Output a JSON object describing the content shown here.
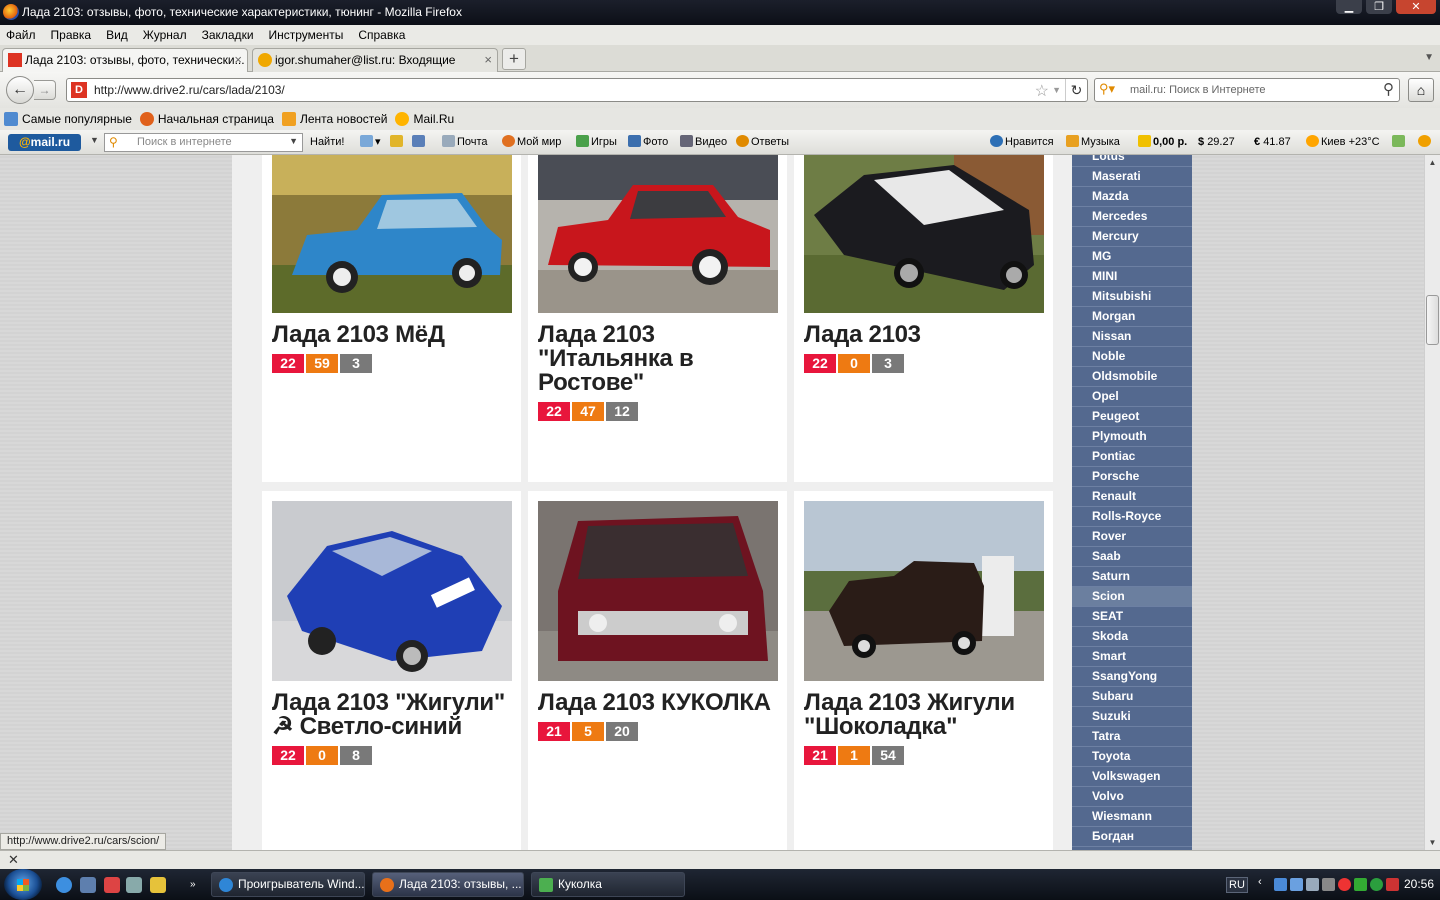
{
  "window": {
    "title": "Лада 2103: отзывы, фото, технические характеристики, тюнинг - Mozilla Firefox"
  },
  "menu": [
    "Файл",
    "Правка",
    "Вид",
    "Журнал",
    "Закладки",
    "Инструменты",
    "Справка"
  ],
  "tabs": [
    {
      "label": "Лада 2103: отзывы, фото, технически..."
    },
    {
      "label": "igor.shumaher@list.ru: Входящие"
    }
  ],
  "nav": {
    "url": "http://www.drive2.ru/cars/lada/2103/",
    "site_icon": "D",
    "search_placeholder": "mail.ru: Поиск в Интернете"
  },
  "bookmarks": [
    "Самые популярные",
    "Начальная страница",
    "Лента новостей",
    "Mail.Ru"
  ],
  "mailbar": {
    "logo": "mail.ru",
    "search_placeholder": "Поиск в интернете",
    "find": "Найти!",
    "items": [
      "Почта",
      "Мой мир",
      "Игры",
      "Фото",
      "Видео",
      "Ответы"
    ],
    "like": "Нравится",
    "music": "Музыка",
    "balance": "0,00 р.",
    "usd": "29.27",
    "eur": "41.87",
    "weather": "Киев +23°C"
  },
  "cars": [
    {
      "title": "Лада 2103 МёД",
      "stats": [
        "22",
        "59",
        "3"
      ],
      "body": "#2e86c9"
    },
    {
      "title": "Лада 2103 \"Итальянка в Ростове\"",
      "stats": [
        "22",
        "47",
        "12"
      ],
      "body": "#c8161c"
    },
    {
      "title": "Лада 2103",
      "stats": [
        "22",
        "0",
        "3"
      ],
      "body": "#1b1b1f"
    },
    {
      "title": "Лада 2103 \"Жигули\" ☭ Светло-синий",
      "stats": [
        "22",
        "0",
        "8"
      ],
      "body": "#1f3fb5"
    },
    {
      "title": "Лада 2103 КУКОЛКА",
      "stats": [
        "21",
        "5",
        "20"
      ],
      "body": "#6e1320"
    },
    {
      "title": "Лада 2103 Жигули \"Шоколадка\"",
      "stats": [
        "21",
        "1",
        "54"
      ],
      "body": "#2a1c17"
    }
  ],
  "brands": [
    "Lotus",
    "Maserati",
    "Mazda",
    "Mercedes",
    "Mercury",
    "MG",
    "MINI",
    "Mitsubishi",
    "Morgan",
    "Nissan",
    "Noble",
    "Oldsmobile",
    "Opel",
    "Peugeot",
    "Plymouth",
    "Pontiac",
    "Porsche",
    "Renault",
    "Rolls-Royce",
    "Rover",
    "Saab",
    "Saturn",
    "Scion",
    "SEAT",
    "Skoda",
    "Smart",
    "SsangYong",
    "Subaru",
    "Suzuki",
    "Tatra",
    "Toyota",
    "Volkswagen",
    "Volvo",
    "Wiesmann",
    "Богдан"
  ],
  "hovered_brand": "Scion",
  "status_url": "http://www.drive2.ru/cars/scion/",
  "taskbar": {
    "tasks": [
      "Проигрыватель Wind...",
      "Лада 2103: отзывы, ...",
      "Куколка"
    ],
    "lang": "RU",
    "clock": "20:56"
  },
  "colors": {
    "stat_red": "#e8163c",
    "stat_orange": "#ee7a12",
    "stat_gray": "#797979",
    "brand_panel": "#54698f"
  }
}
